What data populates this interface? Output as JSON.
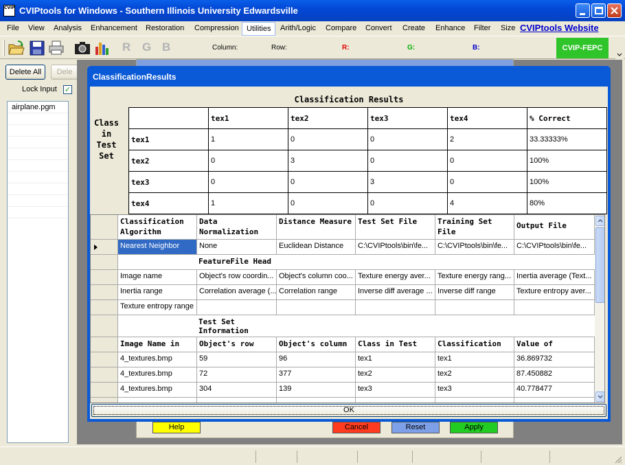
{
  "window": {
    "title": "CVIPtools for Windows - Southern Illinois University Edwardsville",
    "icon_text": "CVIP"
  },
  "menu": {
    "items": [
      "File",
      "View",
      "Analysis",
      "Enhancement",
      "Restoration",
      "Compression",
      "Utilities",
      "Arith/Logic",
      "Compare",
      "Convert",
      "Create",
      "Enhance",
      "Filter",
      "Size"
    ],
    "active": "Utilities",
    "website_link": "CVIPtools Website"
  },
  "toolbar": {
    "r_letter": "R",
    "g_letter": "G",
    "b_letter": "B",
    "column_label": "Column:",
    "row_label": "Row:",
    "r_label": "R:",
    "g_label": "G:",
    "b_label": "B:",
    "fepc_button": "CVIP-FEPC",
    "colors": {
      "r": "#e00000",
      "g": "#00b000",
      "b": "#0000cc",
      "fepc": "#2fc42a"
    }
  },
  "left_panel": {
    "delete_all": "Delete All",
    "delete": "Dele",
    "lock_input_label": "Lock Input",
    "lock_input_checked": true,
    "files": [
      "airplane.pgm"
    ]
  },
  "back_dialog": {
    "buttons": [
      {
        "label": "Help",
        "color": "#ffff00"
      },
      {
        "label": "Cancel",
        "color": "#ff3b1f"
      },
      {
        "label": "Reset",
        "color": "#7ea0e8"
      },
      {
        "label": "Apply",
        "color": "#22cc22"
      }
    ]
  },
  "results_dialog": {
    "title": "ClassificationResults",
    "heading": "Classification Results",
    "class_in_test_set": "Class in Test Set",
    "confusion": {
      "columns": [
        "tex1",
        "tex2",
        "tex3",
        "tex4",
        "% Correct"
      ],
      "rows": [
        {
          "label": "tex1",
          "values": [
            "1",
            "0",
            "0",
            "2",
            "33.33333%"
          ]
        },
        {
          "label": "tex2",
          "values": [
            "0",
            "3",
            "0",
            "0",
            "100%"
          ]
        },
        {
          "label": "tex3",
          "values": [
            "0",
            "0",
            "3",
            "0",
            "100%"
          ]
        },
        {
          "label": "tex4",
          "values": [
            "1",
            "0",
            "0",
            "4",
            "80%"
          ]
        }
      ]
    },
    "grid": {
      "header": [
        "Classification Algorithm",
        "Data Normalization",
        "Distance Measure",
        "Test Set File",
        "Training Set File",
        "Output File"
      ],
      "selected_row": [
        "Nearest Neighbor",
        "None",
        "Euclidean Distance",
        "C:\\CVIPtools\\bin\\fe...",
        "C:\\CVIPtools\\bin\\fe...",
        "C:\\CVIPtools\\bin\\fe..."
      ],
      "feature_section": "FeatureFile Head",
      "feature_rows": [
        [
          "Image name",
          "Object's row coordin...",
          "Object's column coo...",
          "Texture energy aver...",
          "Texture energy rang...",
          "Inertia average (Text..."
        ],
        [
          "Inertia range",
          "Correlation average (...",
          "Correlation range",
          "Inverse diff average ...",
          "Inverse diff range",
          "Texture entropy aver..."
        ],
        [
          "Texture entropy range",
          "",
          "",
          "",
          "",
          ""
        ]
      ],
      "test_section": "Test Set Information",
      "test_header": [
        "Image Name in",
        "Object's row",
        "Object's column",
        "Class in Test",
        "Classification",
        "Value of"
      ],
      "test_rows": [
        [
          "4_textures.bmp",
          "59",
          "96",
          "tex1",
          "tex1",
          "36.869732"
        ],
        [
          "4_textures.bmp",
          "72",
          "377",
          "tex2",
          "tex2",
          "87.450882"
        ],
        [
          "4_textures.bmp",
          "304",
          "139",
          "tex3",
          "tex3",
          "40.778477"
        ]
      ]
    },
    "ok_button": "OK"
  }
}
